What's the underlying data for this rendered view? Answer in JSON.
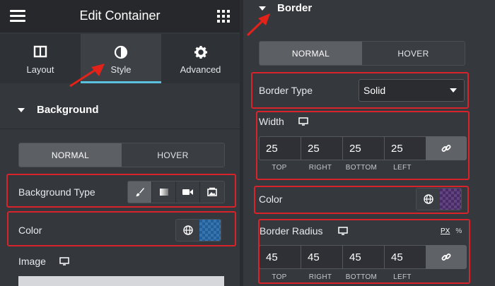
{
  "header": {
    "title": "Edit Container",
    "menu_icon": "hamburger-icon",
    "apps_icon": "grid-icon"
  },
  "tabs": [
    {
      "label": "Layout",
      "icon": "layout-icon",
      "active": false
    },
    {
      "label": "Style",
      "icon": "style-icon",
      "active": true
    },
    {
      "label": "Advanced",
      "icon": "gear-icon",
      "active": false
    }
  ],
  "background_section": {
    "title": "Background",
    "state_toggle": {
      "normal": "NORMAL",
      "hover": "HOVER",
      "selected": "NORMAL"
    },
    "background_type": {
      "label": "Background Type",
      "options": [
        "brush-icon",
        "gradient-icon",
        "video-icon",
        "slideshow-icon"
      ],
      "selected": "brush-icon"
    },
    "color": {
      "label": "Color",
      "swatch": "#1f5f9e"
    },
    "image": {
      "label": "Image"
    }
  },
  "border_section": {
    "title": "Border",
    "state_toggle": {
      "normal": "NORMAL",
      "hover": "HOVER",
      "selected": "NORMAL"
    },
    "border_type": {
      "label": "Border Type",
      "value": "Solid"
    },
    "width": {
      "label": "Width",
      "values": [
        "25",
        "25",
        "25",
        "25"
      ],
      "sides": [
        "TOP",
        "RIGHT",
        "BOTTOM",
        "LEFT"
      ]
    },
    "color": {
      "label": "Color",
      "swatch": "#4a2a6a"
    },
    "radius": {
      "label": "Border Radius",
      "values": [
        "45",
        "45",
        "45",
        "45"
      ],
      "sides": [
        "TOP",
        "RIGHT",
        "BOTTOM",
        "LEFT"
      ],
      "units": [
        "PX",
        "%"
      ]
    }
  },
  "colors": {
    "highlight": "#d8232a",
    "arrow": "#e32219",
    "active_tab": "#5bc0de"
  }
}
